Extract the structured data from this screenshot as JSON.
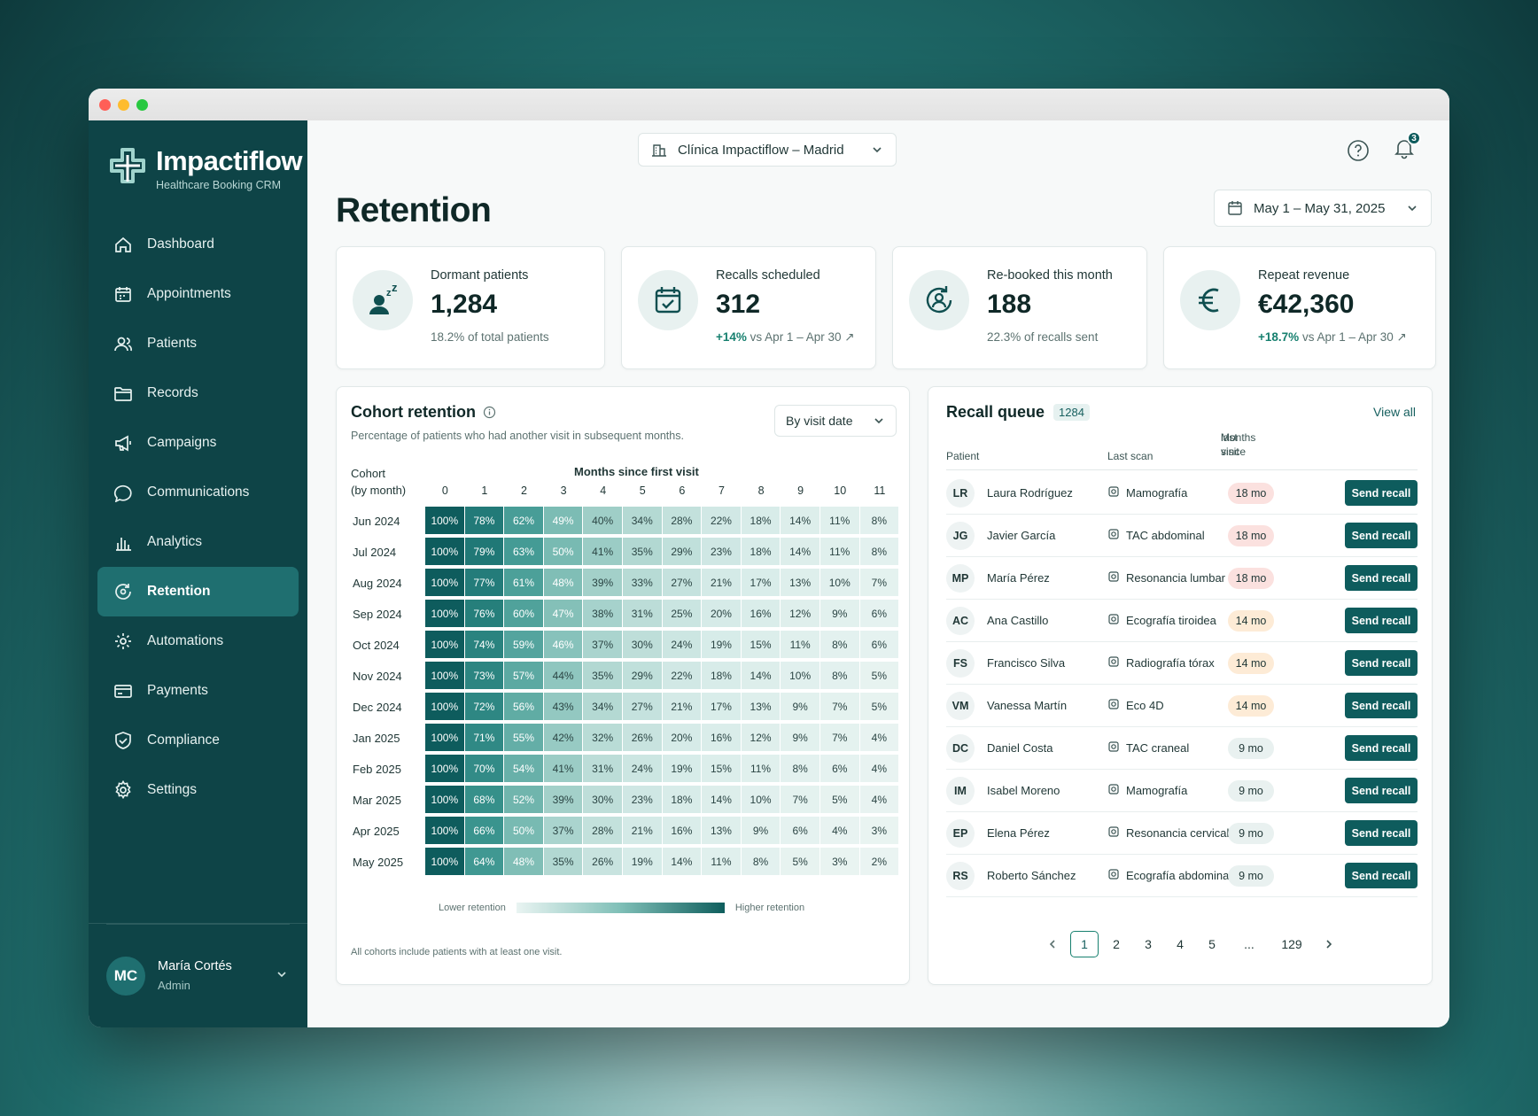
{
  "brand": {
    "name": "Impactiflow",
    "subtitle": "Healthcare Booking CRM"
  },
  "nav": [
    {
      "label": "Dashboard",
      "icon": "home-icon"
    },
    {
      "label": "Appointments",
      "icon": "calendar-icon"
    },
    {
      "label": "Patients",
      "icon": "users-icon"
    },
    {
      "label": "Records",
      "icon": "folder-icon"
    },
    {
      "label": "Campaigns",
      "icon": "megaphone-icon"
    },
    {
      "label": "Communications",
      "icon": "chat-icon"
    },
    {
      "label": "Analytics",
      "icon": "bar-chart-icon"
    },
    {
      "label": "Retention",
      "icon": "retention-icon",
      "active": true
    },
    {
      "label": "Automations",
      "icon": "cog-icon"
    },
    {
      "label": "Payments",
      "icon": "card-icon"
    },
    {
      "label": "Compliance",
      "icon": "shield-icon"
    },
    {
      "label": "Settings",
      "icon": "gear-icon"
    }
  ],
  "user": {
    "initials": "MC",
    "name": "María Cortés",
    "role": "Admin"
  },
  "header": {
    "clinic": "Clínica Impactiflow – Madrid",
    "notifications": "3",
    "title": "Retention",
    "date_range": "May 1 – May 31, 2025"
  },
  "kpis": [
    {
      "label": "Dormant patients",
      "value": "1,284",
      "sub": "18.2% of total patients",
      "up": ""
    },
    {
      "label": "Recalls scheduled",
      "value": "312",
      "up": "+14%",
      "sub": "vs Apr 1 – Apr 30 ↗"
    },
    {
      "label": "Re-booked this month",
      "value": "188",
      "sub": "22.3% of recalls sent",
      "up": ""
    },
    {
      "label": "Repeat revenue",
      "value": "€42,360",
      "up": "+18.7%",
      "sub": "vs Apr 1 – Apr 30 ↗"
    }
  ],
  "cohort": {
    "title": "Cohort retention",
    "subtitle": "Percentage of patients who had another visit in subsequent months.",
    "filter": "By visit date",
    "row_header": "Cohort",
    "row_header2": "(by month)",
    "col_title": "Months since first visit",
    "legend_low": "Lower retention",
    "legend_high": "Higher retention",
    "footnote": "All cohorts include patients with at least one visit."
  },
  "chart_data": {
    "type": "heatmap",
    "title": "Cohort retention",
    "xlabel": "Months since first visit",
    "ylabel": "Cohort (by month)",
    "x": [
      "0",
      "1",
      "2",
      "3",
      "4",
      "5",
      "6",
      "7",
      "8",
      "9",
      "10",
      "11"
    ],
    "y": [
      "Jun 2024",
      "Jul 2024",
      "Aug 2024",
      "Sep 2024",
      "Oct 2024",
      "Nov 2024",
      "Dec 2024",
      "Jan 2025",
      "Feb 2025",
      "Mar 2025",
      "Apr 2025",
      "May 2025"
    ],
    "values": [
      [
        100,
        78,
        62,
        49,
        40,
        34,
        28,
        22,
        18,
        14,
        11,
        8
      ],
      [
        100,
        79,
        63,
        50,
        41,
        35,
        29,
        23,
        18,
        14,
        11,
        8
      ],
      [
        100,
        77,
        61,
        48,
        39,
        33,
        27,
        21,
        17,
        13,
        10,
        7
      ],
      [
        100,
        76,
        60,
        47,
        38,
        31,
        25,
        20,
        16,
        12,
        9,
        6
      ],
      [
        100,
        74,
        59,
        46,
        37,
        30,
        24,
        19,
        15,
        11,
        8,
        6
      ],
      [
        100,
        73,
        57,
        44,
        35,
        29,
        22,
        18,
        14,
        10,
        8,
        5
      ],
      [
        100,
        72,
        56,
        43,
        34,
        27,
        21,
        17,
        13,
        9,
        7,
        5
      ],
      [
        100,
        71,
        55,
        42,
        32,
        26,
        20,
        16,
        12,
        9,
        7,
        4
      ],
      [
        100,
        70,
        54,
        41,
        31,
        24,
        19,
        15,
        11,
        8,
        6,
        4
      ],
      [
        100,
        68,
        52,
        39,
        30,
        23,
        18,
        14,
        10,
        7,
        5,
        4
      ],
      [
        100,
        66,
        50,
        37,
        28,
        21,
        16,
        13,
        9,
        6,
        4,
        3
      ],
      [
        100,
        64,
        48,
        35,
        26,
        19,
        14,
        11,
        8,
        5,
        3,
        2
      ]
    ],
    "unit": "%"
  },
  "recall": {
    "title": "Recall queue",
    "count": "1284",
    "view_all": "View all",
    "col_patient": "Patient",
    "col_scan": "Last scan",
    "col_months": "Months since",
    "col_months2": "last visit",
    "action": "Send recall",
    "rows": [
      {
        "ini": "LR",
        "name": "Laura Rodríguez",
        "scan": "Mamografía",
        "mo": "18 mo",
        "level": "high"
      },
      {
        "ini": "JG",
        "name": "Javier García",
        "scan": "TAC abdominal",
        "mo": "18 mo",
        "level": "high"
      },
      {
        "ini": "MP",
        "name": "María Pérez",
        "scan": "Resonancia lumbar",
        "mo": "18 mo",
        "level": "high"
      },
      {
        "ini": "AC",
        "name": "Ana Castillo",
        "scan": "Ecografía tiroidea",
        "mo": "14 mo",
        "level": "mid"
      },
      {
        "ini": "FS",
        "name": "Francisco Silva",
        "scan": "Radiografía tórax",
        "mo": "14 mo",
        "level": "mid"
      },
      {
        "ini": "VM",
        "name": "Vanessa Martín",
        "scan": "Eco 4D",
        "mo": "14 mo",
        "level": "mid"
      },
      {
        "ini": "DC",
        "name": "Daniel Costa",
        "scan": "TAC craneal",
        "mo": "9 mo",
        "level": "low"
      },
      {
        "ini": "IM",
        "name": "Isabel Moreno",
        "scan": "Mamografía",
        "mo": "9 mo",
        "level": "low"
      },
      {
        "ini": "EP",
        "name": "Elena Pérez",
        "scan": "Resonancia cervical",
        "mo": "9 mo",
        "level": "low"
      },
      {
        "ini": "RS",
        "name": "Roberto Sánchez",
        "scan": "Ecografía abdominal",
        "mo": "9 mo",
        "level": "low"
      }
    ],
    "pages": [
      "1",
      "2",
      "3",
      "4",
      "5",
      "...",
      "129"
    ],
    "current_page": "1"
  },
  "colors": {
    "sidebar": "#0e4447",
    "accent": "#0e5c5d",
    "active": "#1f6f70"
  }
}
